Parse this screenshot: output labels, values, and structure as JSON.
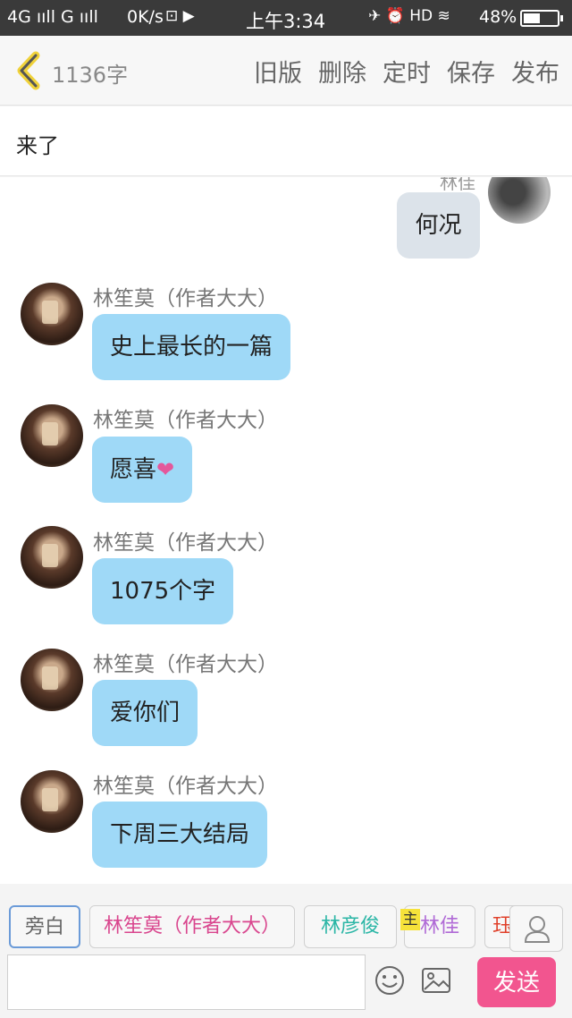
{
  "status_bar": {
    "signal": "4G ııll G ııll",
    "speed": "0K/s",
    "icons": "⊡ ▶",
    "time": "上午3:34",
    "right_icons": "✈ ⏰ HD ≋",
    "battery": "48%"
  },
  "header": {
    "word_count": "1136字",
    "actions": [
      "旧版",
      "删除",
      "定时",
      "保存",
      "发布"
    ]
  },
  "title": "来了",
  "chat": {
    "right_message": {
      "name": "林佳",
      "text": "何况"
    },
    "messages": [
      {
        "name": "林笙莫（作者大大）",
        "text": "史上最长的一篇"
      },
      {
        "name": "林笙莫（作者大大）",
        "text": "愿喜",
        "emoji": "❤"
      },
      {
        "name": "林笙莫（作者大大）",
        "text": "1075个字"
      },
      {
        "name": "林笙莫（作者大大）",
        "text": "爱你们"
      },
      {
        "name": "林笙莫（作者大大）",
        "text": "下周三大结局"
      }
    ]
  },
  "roles": {
    "items": [
      "旁白",
      "林笙莫（作者大大）",
      "林彦俊",
      "林佳",
      "珏"
    ],
    "host_badge": "主"
  },
  "input": {
    "value": "",
    "send_label": "发送"
  },
  "colors": {
    "bubble": "#9fd9f7",
    "send": "#f2558f",
    "author": "#d9468e"
  }
}
